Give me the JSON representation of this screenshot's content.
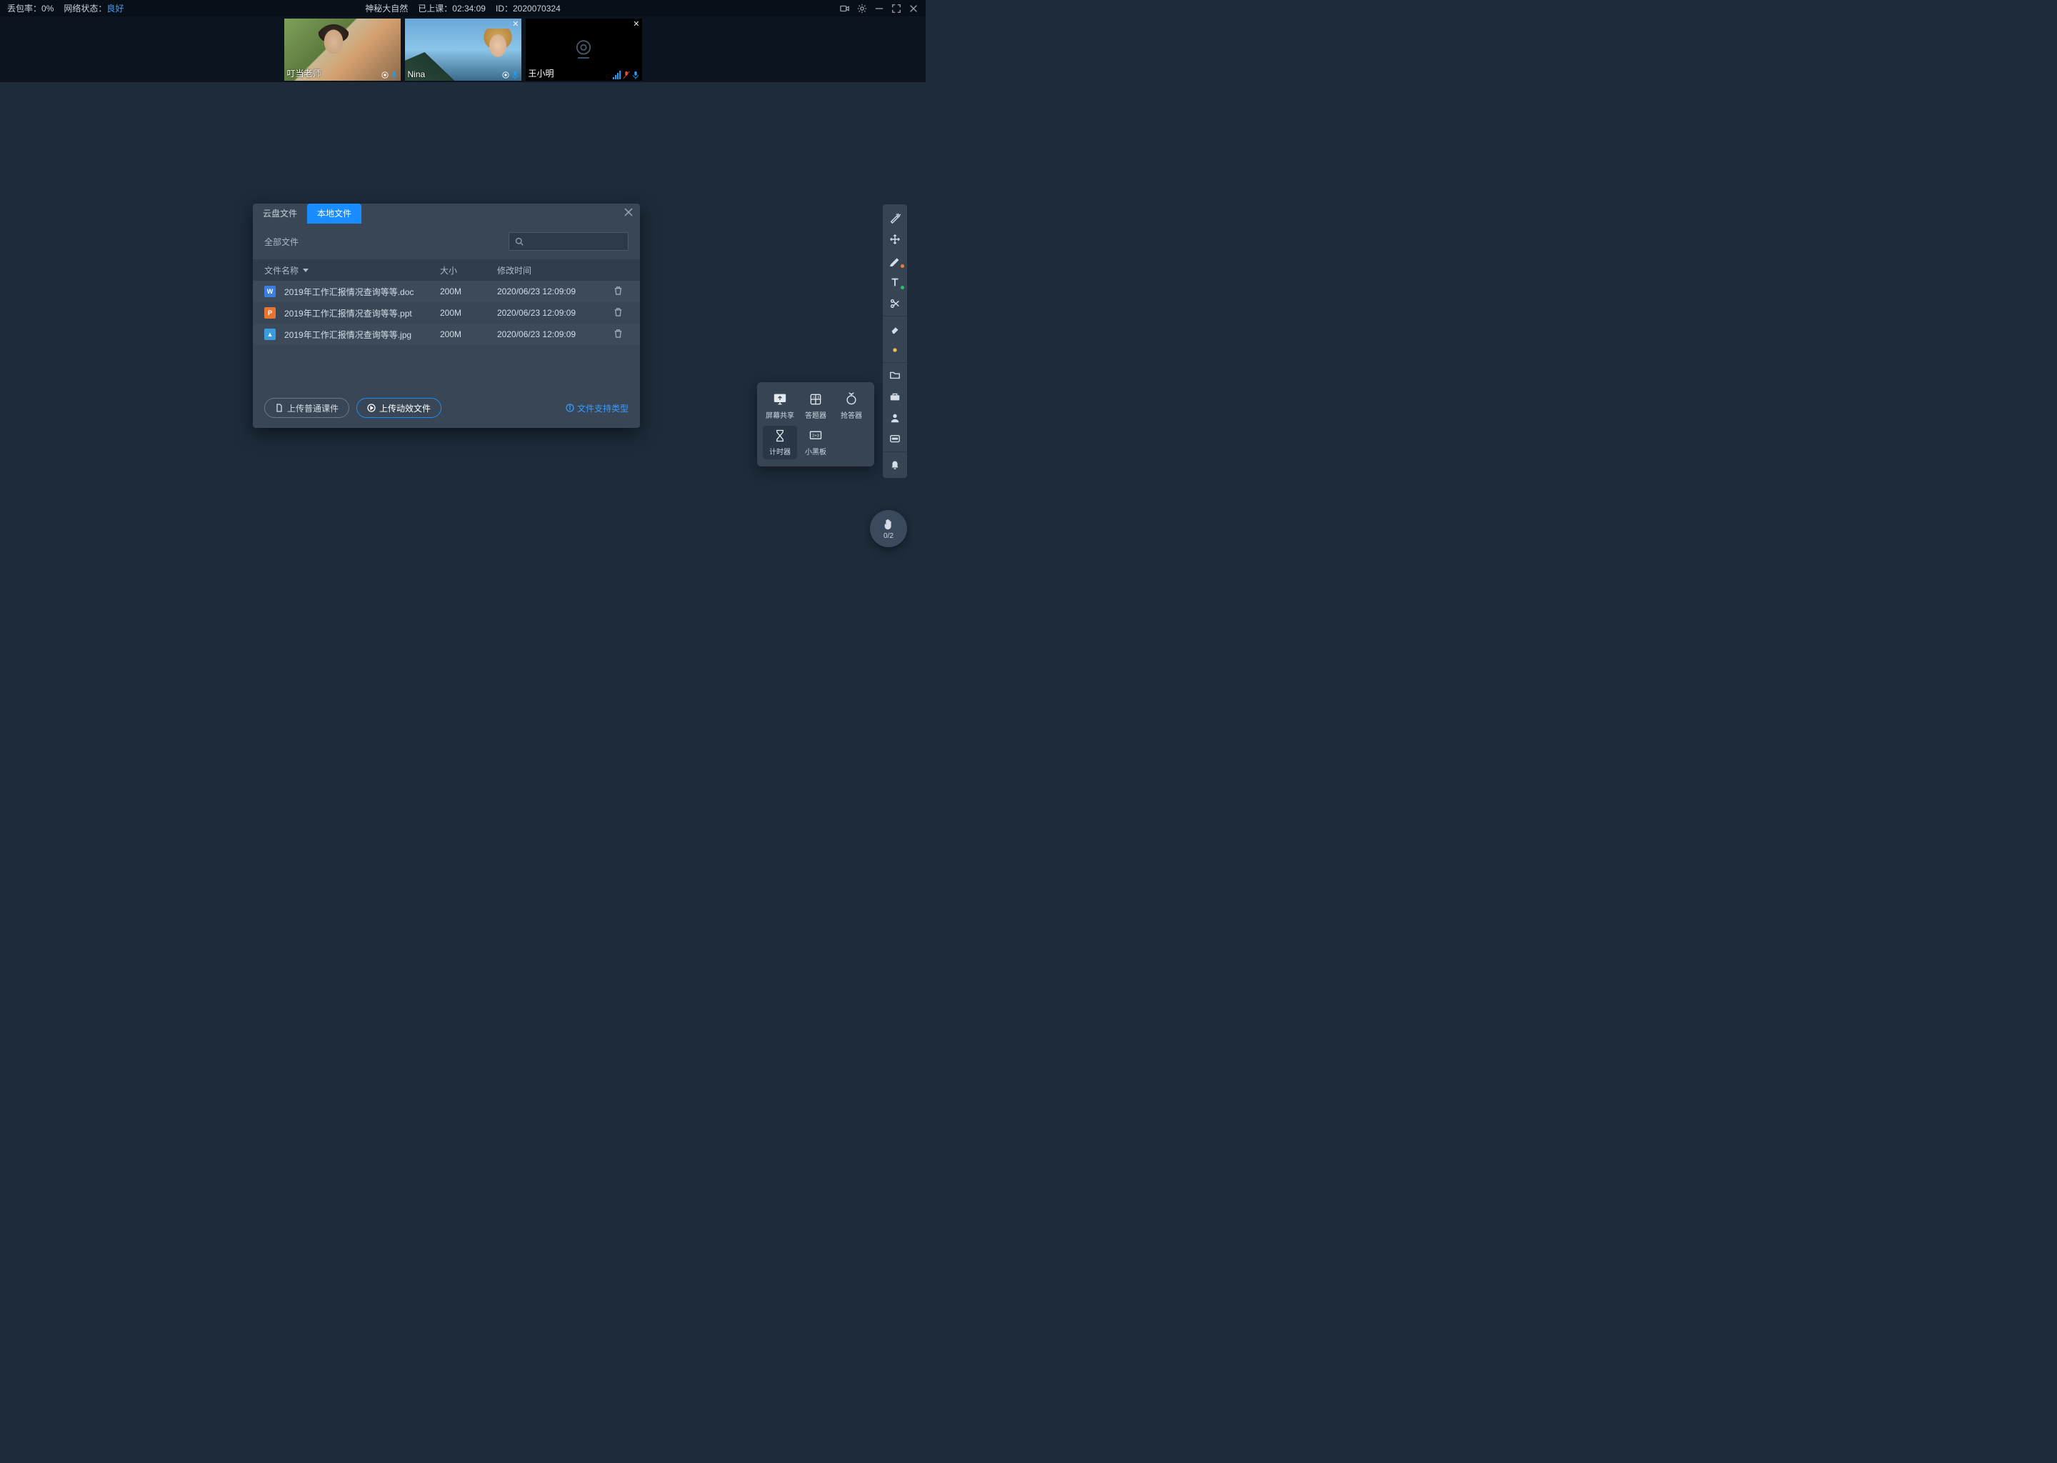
{
  "topbar": {
    "packet_loss_label": "丢包率：",
    "packet_loss_value": "0%",
    "network_label": "网络状态：",
    "network_value": "良好",
    "title": "神秘大自然",
    "duration_label": "已上课：",
    "duration_value": "02:34:09",
    "id_label": "ID：",
    "id_value": "2020070324"
  },
  "videos": [
    {
      "name": "叮当老师",
      "cam": true,
      "photo": "photo1",
      "closable": false,
      "bars": true,
      "mic": "on"
    },
    {
      "name": "Nina",
      "cam": true,
      "photo": "photo2",
      "closable": true,
      "bars": true,
      "mic": "on"
    },
    {
      "name": "王小明",
      "cam": false,
      "photo": "",
      "closable": true,
      "bars": true,
      "mic": "muted"
    }
  ],
  "dialog": {
    "tabs": [
      "云盘文件",
      "本地文件"
    ],
    "active_tab": 1,
    "filter_label": "全部文件",
    "columns": {
      "name": "文件名称",
      "size": "大小",
      "time": "修改时间"
    },
    "files": [
      {
        "icon": "W",
        "cls": "fi-doc",
        "name": "2019年工作汇报情况查询等等.doc",
        "size": "200M",
        "time": "2020/06/23 12:09:09"
      },
      {
        "icon": "P",
        "cls": "fi-ppt",
        "name": "2019年工作汇报情况查询等等.ppt",
        "size": "200M",
        "time": "2020/06/23 12:09:09"
      },
      {
        "icon": "▲",
        "cls": "fi-img",
        "name": "2019年工作汇报情况查询等等.jpg",
        "size": "200M",
        "time": "2020/06/23 12:09:09"
      }
    ],
    "btn_upload_normal": "上传普通课件",
    "btn_upload_anim": "上传动效文件",
    "link_support": "文件支持类型"
  },
  "floatpanel": [
    {
      "key": "screen-share",
      "label": "屏幕共享"
    },
    {
      "key": "answer",
      "label": "答题器"
    },
    {
      "key": "buzzer",
      "label": "抢答器"
    },
    {
      "key": "timer",
      "label": "计时器",
      "active": true
    },
    {
      "key": "blackboard",
      "label": "小黑板"
    }
  ],
  "hand": {
    "count": "0/2"
  }
}
